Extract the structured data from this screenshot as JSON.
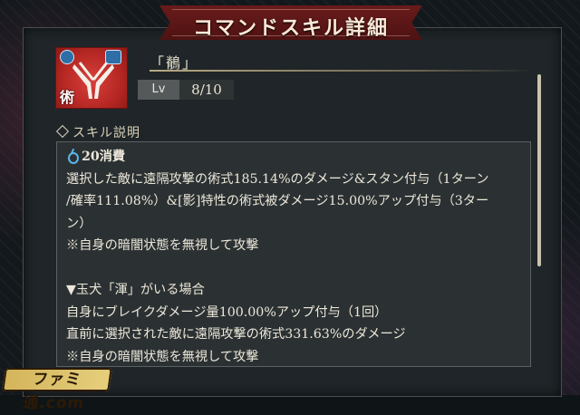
{
  "header": {
    "title": "コマンドスキル詳細"
  },
  "skill": {
    "name": "「鶺」",
    "icon_badge": "術",
    "level_label": "Lv",
    "level_value": "8/10"
  },
  "description": {
    "section_title": "スキル説明",
    "cost": "20消費",
    "lines": [
      "選択した敵に遠隔攻撃の術式185.14%のダメージ&スタン付与（1ターン",
      "/確率111.08%）&[影]特性の術式被ダメージ15.00%アップ付与（3ター",
      "ン）",
      "※自身の暗闇状態を無視して攻撃",
      "",
      "▼玉犬「渾」がいる場合",
      "自身にブレイクダメージ量100.00%アップ付与（1回）",
      "直前に選択された敵に遠隔攻撃の術式331.63%のダメージ",
      "※自身の暗闇状態を無視して攻撃"
    ]
  },
  "watermark": {
    "text": "ファミ通.com"
  },
  "colors": {
    "banner": "#6a1b1b",
    "panel": "#1f2528",
    "icon_red": "#b52723",
    "cost_icon": "#5ab6e8"
  }
}
